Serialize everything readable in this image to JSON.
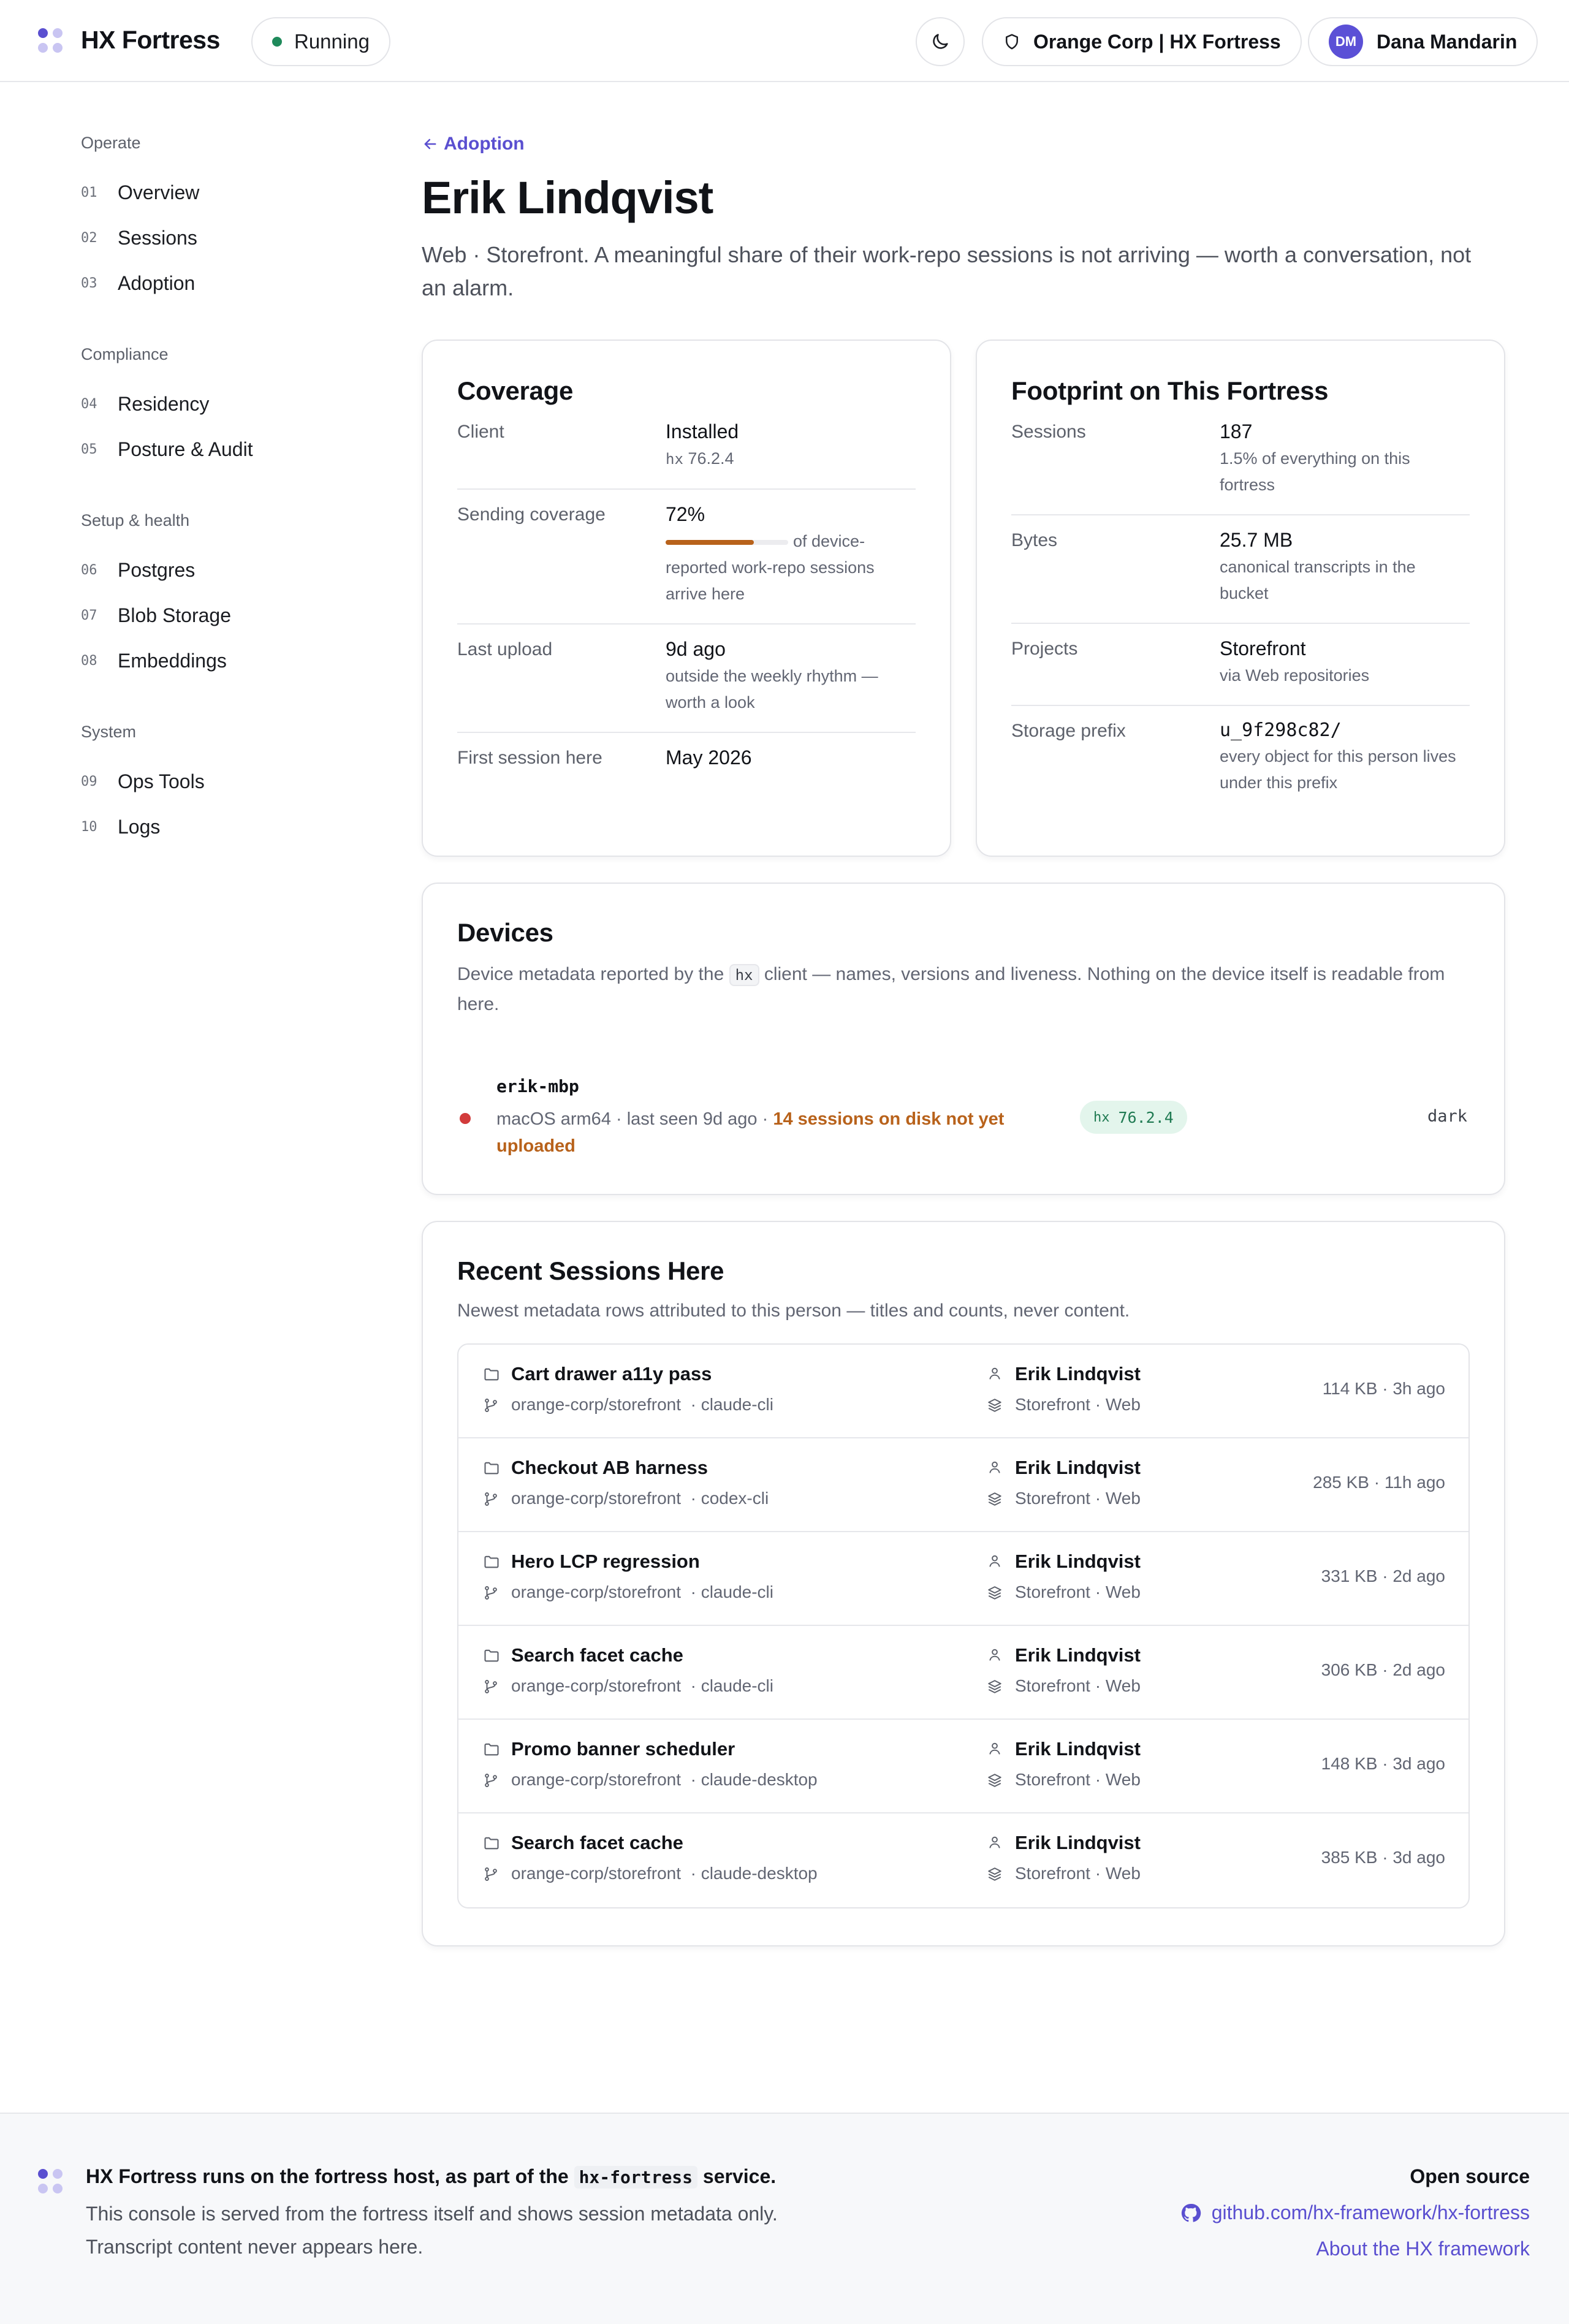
{
  "header": {
    "brand": "HX Fortress",
    "status": "Running",
    "org": "Orange Corp | HX Fortress",
    "user_initials": "DM",
    "user_name": "Dana Mandarin"
  },
  "sidebar": {
    "groups": [
      {
        "title": "Operate",
        "items": [
          {
            "num": "01",
            "label": "Overview"
          },
          {
            "num": "02",
            "label": "Sessions"
          },
          {
            "num": "03",
            "label": "Adoption"
          }
        ]
      },
      {
        "title": "Compliance",
        "items": [
          {
            "num": "04",
            "label": "Residency"
          },
          {
            "num": "05",
            "label": "Posture & Audit"
          }
        ]
      },
      {
        "title": "Setup & health",
        "items": [
          {
            "num": "06",
            "label": "Postgres"
          },
          {
            "num": "07",
            "label": "Blob Storage"
          },
          {
            "num": "08",
            "label": "Embeddings"
          }
        ]
      },
      {
        "title": "System",
        "items": [
          {
            "num": "09",
            "label": "Ops Tools"
          },
          {
            "num": "10",
            "label": "Logs"
          }
        ]
      }
    ]
  },
  "page": {
    "back_label": "Adoption",
    "title": "Erik Lindqvist",
    "description": "Web · Storefront. A meaningful share of their work-repo sessions is not arriving — worth a conversation, not an alarm."
  },
  "coverage": {
    "title": "Coverage",
    "client_key": "Client",
    "client_value": "Installed",
    "client_prefix": "hx",
    "client_version": "76.2.4",
    "sending_key": "Sending coverage",
    "sending_value": "72%",
    "sending_fraction": 0.72,
    "sending_sub": "of device-reported work-repo sessions arrive here",
    "upload_key": "Last upload",
    "upload_value": "9d ago",
    "upload_sub": "outside the weekly rhythm — worth a look",
    "first_key": "First session here",
    "first_value": "May 2026"
  },
  "footprint": {
    "title": "Footprint on This Fortress",
    "sessions_key": "Sessions",
    "sessions_value": "187",
    "sessions_sub": "1.5% of everything on this fortress",
    "bytes_key": "Bytes",
    "bytes_value": "25.7 MB",
    "bytes_sub": "canonical transcripts in the bucket",
    "projects_key": "Projects",
    "projects_value": "Storefront",
    "projects_sub": "via Web repositories",
    "prefix_key": "Storage prefix",
    "prefix_value": "u_9f298c82/",
    "prefix_sub": "every object for this person lives under this prefix"
  },
  "devices": {
    "title": "Devices",
    "desc_before": "Device metadata reported by the",
    "desc_code": "hx",
    "desc_after": "client — names, versions and liveness. Nothing on the device itself is readable from here.",
    "device_name": "erik-mbp",
    "device_meta": "macOS arm64 · last seen 9d ago ·",
    "device_warning": "14 sessions on disk not yet uploaded",
    "badge_prefix": "hx",
    "badge_version": "76.2.4",
    "theme": "dark",
    "status_color": "#d23b3b"
  },
  "sessions": {
    "title": "Recent Sessions Here",
    "desc": "Newest metadata rows attributed to this person — titles and counts, never content.",
    "rows": [
      {
        "title": "Cart drawer a11y pass",
        "repo": "orange-corp/storefront",
        "client": "· claude-cli",
        "person": "Erik Lindqvist",
        "project": "Storefront · Web",
        "meta": "114 KB · 3h ago"
      },
      {
        "title": "Checkout AB harness",
        "repo": "orange-corp/storefront",
        "client": "· codex-cli",
        "person": "Erik Lindqvist",
        "project": "Storefront · Web",
        "meta": "285 KB · 11h ago"
      },
      {
        "title": "Hero LCP regression",
        "repo": "orange-corp/storefront",
        "client": "· claude-cli",
        "person": "Erik Lindqvist",
        "project": "Storefront · Web",
        "meta": "331 KB · 2d ago"
      },
      {
        "title": "Search facet cache",
        "repo": "orange-corp/storefront",
        "client": "· claude-cli",
        "person": "Erik Lindqvist",
        "project": "Storefront · Web",
        "meta": "306 KB · 2d ago"
      },
      {
        "title": "Promo banner scheduler",
        "repo": "orange-corp/storefront",
        "client": "· claude-desktop",
        "person": "Erik Lindqvist",
        "project": "Storefront · Web",
        "meta": "148 KB · 3d ago"
      },
      {
        "title": "Search facet cache",
        "repo": "orange-corp/storefront",
        "client": "· claude-desktop",
        "person": "Erik Lindqvist",
        "project": "Storefront · Web",
        "meta": "385 KB · 3d ago"
      }
    ]
  },
  "footer": {
    "head_before": "HX Fortress runs on the fortress host, as part of the",
    "head_code": "hx-fortress",
    "head_after": "service.",
    "line1": "This console is served from the fortress itself and shows session metadata only.",
    "line2": "Transcript content never appears here.",
    "right_title": "Open source",
    "github_link": "github.com/hx-framework/hx-fortress",
    "about_link": "About the HX framework"
  },
  "icons": {
    "theme": "moon-icon",
    "org": "shield-icon",
    "back": "arrow-left-icon",
    "folder": "folder-icon",
    "branch": "git-branch-icon",
    "person": "user-icon",
    "layers": "layers-icon",
    "github": "github-icon"
  },
  "colors": {
    "accent": "#5a4fd0",
    "running": "#1f8a5b",
    "warning": "#b8621b",
    "badge_bg": "#e3f5ec",
    "badge_text": "#1f7a52"
  }
}
